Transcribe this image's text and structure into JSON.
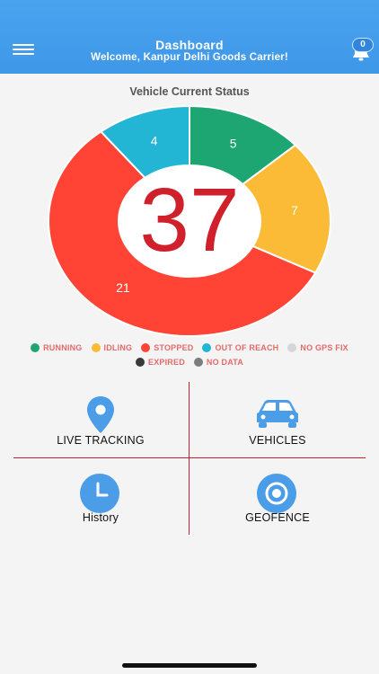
{
  "header": {
    "title": "Dashboard",
    "subtitle": "Welcome, Kanpur Delhi  Goods Carrier!",
    "notification_count": "0",
    "menu_icon": "hamburger-menu-icon",
    "bell_icon": "bell-icon",
    "color": "#4aa3ef"
  },
  "chart_section": {
    "title": "Vehicle Current Status",
    "center_total": "37"
  },
  "chart_data": {
    "type": "pie",
    "title": "Vehicle Current Status",
    "total": 37,
    "slices": [
      {
        "label": "RUNNING",
        "value": 5,
        "color": "#1ea672"
      },
      {
        "label": "IDLING",
        "value": 7,
        "color": "#fcbb37"
      },
      {
        "label": "STOPPED",
        "value": 21,
        "color": "#ff4436"
      },
      {
        "label": "OUT OF REACH",
        "value": 4,
        "color": "#22b5d4"
      }
    ],
    "legend_placement": "bottom"
  },
  "legend": {
    "row1": [
      {
        "label": "RUNNING",
        "color": "#1ea672"
      },
      {
        "label": "IDLING",
        "color": "#fcbb37"
      },
      {
        "label": "STOPPED",
        "color": "#ff4436"
      },
      {
        "label": "OUT OF REACH",
        "color": "#22b5d4"
      },
      {
        "label": "NO GPS FIX",
        "color": "#d6d6d6"
      }
    ],
    "row2": [
      {
        "label": "EXPIRED",
        "color": "#3a3a3a"
      },
      {
        "label": "NO DATA",
        "color": "#7c7c7c"
      }
    ]
  },
  "tiles": {
    "live_tracking": {
      "label": "LIVE TRACKING",
      "icon": "map-pin-icon"
    },
    "vehicles": {
      "label": "VEHICLES",
      "icon": "car-icon"
    },
    "history": {
      "label": "History",
      "icon": "clock-icon"
    },
    "geofence": {
      "label": "GEOFENCE",
      "icon": "target-icon"
    },
    "icon_color": "#4a9de6",
    "divider_color": "#c9202f"
  }
}
